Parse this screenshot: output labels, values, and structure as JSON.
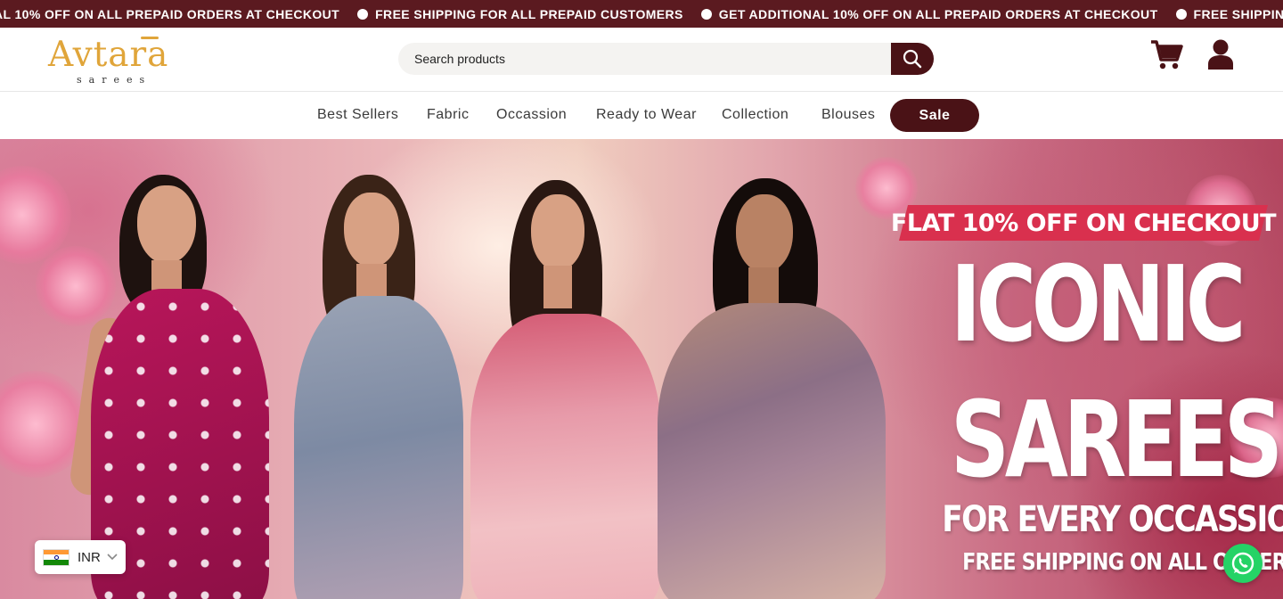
{
  "announcement": {
    "items": [
      "AL 10% OFF ON ALL PREPAID ORDERS AT CHECKOUT",
      "FREE SHIPPING FOR ALL PREPAID CUSTOMERS",
      "GET ADDITIONAL 10% OFF ON ALL PREPAID ORDERS AT CHECKOUT",
      "FREE SHIPPING FOR A"
    ]
  },
  "header": {
    "logo_main": "Avtara",
    "logo_sub": "sarees",
    "search": {
      "placeholder": "Search products"
    },
    "icons": {
      "search": "search-icon",
      "cart": "cart-icon",
      "account": "user-icon"
    }
  },
  "nav": {
    "items": [
      "Best Sellers",
      "Fabric",
      "Occassion",
      "Ready to Wear",
      "Collection",
      "Blouses"
    ],
    "sale": "Sale"
  },
  "hero": {
    "banner": "FLAT 10% OFF ON CHECKOUT",
    "title_line1": "ICONIC",
    "title_line2": "SAREES",
    "subtitle": "FOR EVERY OCCASSION",
    "shipping": "FREE SHIPPING ON ALL ORDERS"
  },
  "currency": {
    "code": "INR",
    "flag": "india-flag-icon"
  },
  "colors": {
    "brand": "#4a1216",
    "announcement_bg": "#5b1a20",
    "logo_gold": "#e0a53a",
    "promo_red": "#d9304e",
    "whatsapp": "#25d366"
  }
}
